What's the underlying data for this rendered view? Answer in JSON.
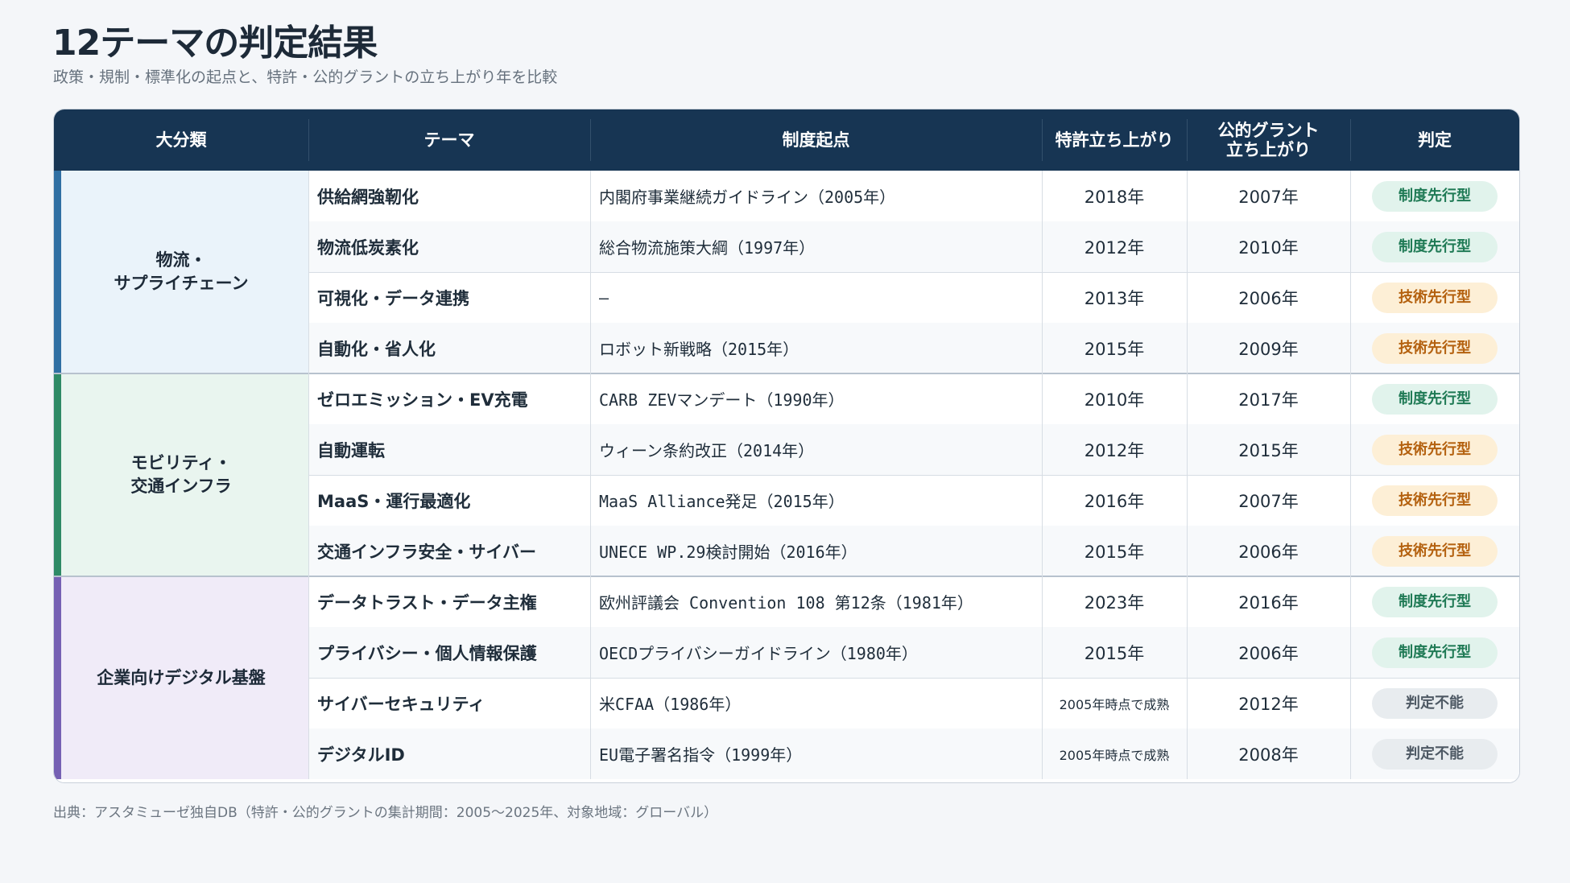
{
  "title": "12テーマの判定結果",
  "subtitle": "政策・規制・標準化の起点と、特許・公的グラントの立ち上がり年を比較",
  "colors": {
    "header_bg": "#173553",
    "group_logistics": "#eaf3fa",
    "group_mobility": "#e9f5ef",
    "group_digital": "#f0ebf8",
    "bar_logistics": "#2f6fa3",
    "bar_mobility": "#2e8a66",
    "bar_digital": "#7560b3",
    "badge_seido": "#e1f3ec",
    "badge_gijutsu": "#fdefd6",
    "badge_fumei": "#e8ecef"
  },
  "headers": {
    "category": "大分類",
    "theme": "テーマ",
    "origin": "制度起点",
    "patent": "特許立ち上がり",
    "grant": "公的グラント\n立ち上がり",
    "verdict": "判定"
  },
  "groups": [
    {
      "label": "物流・\nサプライチェーン"
    },
    {
      "label": "モビリティ・\n交通インフラ"
    },
    {
      "label": "企業向けデジタル基盤"
    }
  ],
  "rows": [
    {
      "theme": "供給網強靭化",
      "origin": "内閣府事業継続ガイドライン（2005年）",
      "patent": "2018年",
      "grant": "2007年",
      "verdict": "制度先行型",
      "verdict_type": "seido"
    },
    {
      "theme": "物流低炭素化",
      "origin": "総合物流施策大綱（1997年）",
      "patent": "2012年",
      "grant": "2010年",
      "verdict": "制度先行型",
      "verdict_type": "seido"
    },
    {
      "theme": "可視化・データ連携",
      "origin": "—",
      "patent": "2013年",
      "grant": "2006年",
      "verdict": "技術先行型",
      "verdict_type": "gijutsu"
    },
    {
      "theme": "自動化・省人化",
      "origin": "ロボット新戦略（2015年）",
      "patent": "2015年",
      "grant": "2009年",
      "verdict": "技術先行型",
      "verdict_type": "gijutsu"
    },
    {
      "theme": "ゼロエミッション・EV充電",
      "origin": "CARB ZEVマンデート（1990年）",
      "patent": "2010年",
      "grant": "2017年",
      "verdict": "制度先行型",
      "verdict_type": "seido"
    },
    {
      "theme": "自動運転",
      "origin": "ウィーン条約改正（2014年）",
      "patent": "2012年",
      "grant": "2015年",
      "verdict": "技術先行型",
      "verdict_type": "gijutsu"
    },
    {
      "theme": "MaaS・運行最適化",
      "origin": "MaaS Alliance発足（2015年）",
      "patent": "2016年",
      "grant": "2007年",
      "verdict": "技術先行型",
      "verdict_type": "gijutsu"
    },
    {
      "theme": "交通インフラ安全・サイバー",
      "origin": "UNECE WP.29検討開始（2016年）",
      "patent": "2015年",
      "grant": "2006年",
      "verdict": "技術先行型",
      "verdict_type": "gijutsu"
    },
    {
      "theme": "データトラスト・データ主権",
      "origin": "欧州評議会 Convention 108 第12条（1981年）",
      "patent": "2023年",
      "grant": "2016年",
      "verdict": "制度先行型",
      "verdict_type": "seido"
    },
    {
      "theme": "プライバシー・個人情報保護",
      "origin": "OECDプライバシーガイドライン（1980年）",
      "patent": "2015年",
      "grant": "2006年",
      "verdict": "制度先行型",
      "verdict_type": "seido"
    },
    {
      "theme": "サイバーセキュリティ",
      "origin": "米CFAA（1986年）",
      "patent": "2005年時点で成熟",
      "grant": "2012年",
      "verdict": "判定不能",
      "verdict_type": "fumei"
    },
    {
      "theme": "デジタルID",
      "origin": "EU電子署名指令（1999年）",
      "patent": "2005年時点で成熟",
      "grant": "2008年",
      "verdict": "判定不能",
      "verdict_type": "fumei"
    }
  ],
  "footer": "出典：アスタミューゼ独自DB（特許・公的グラントの集計期間：2005〜2025年、対象地域：グローバル）"
}
